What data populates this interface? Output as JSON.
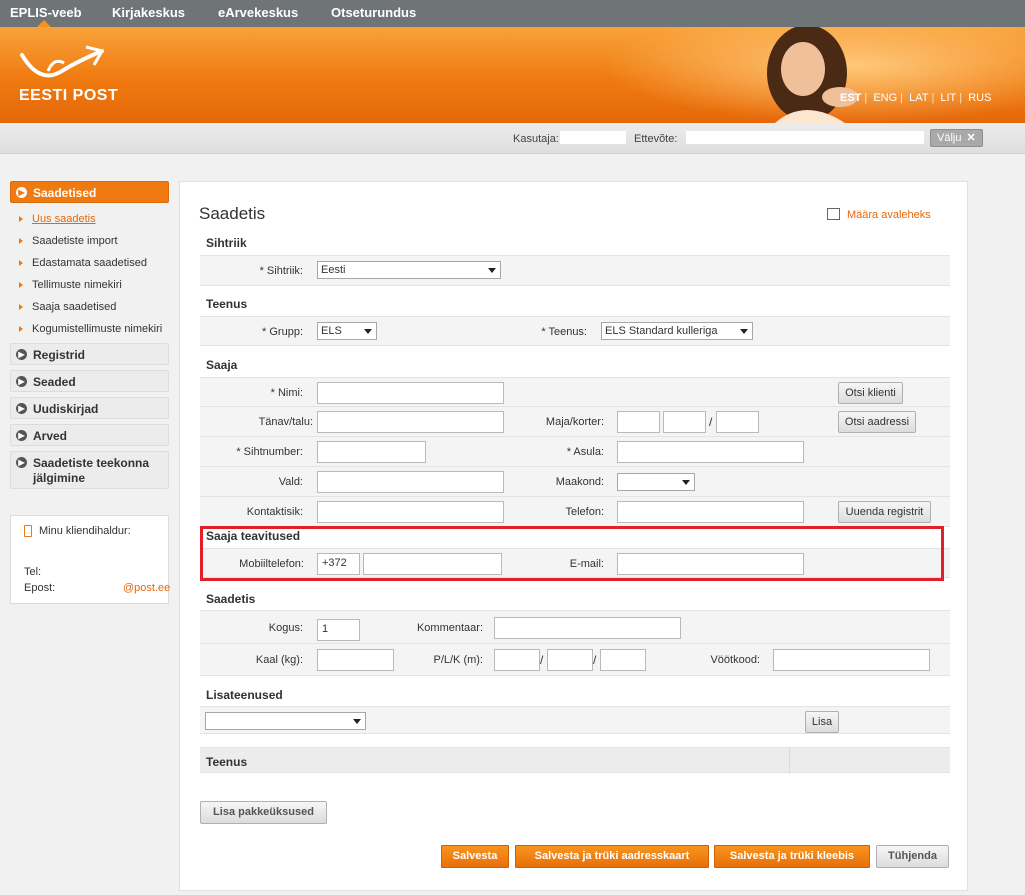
{
  "topnav": {
    "items": [
      "EPLIS-veeb",
      "Kirjakeskus",
      "eArvekeskus",
      "Otseturundus"
    ]
  },
  "brand": {
    "logo_text": "EESTI POST",
    "accent": "#f07a12"
  },
  "languages": [
    "EST",
    "ENG",
    "LAT",
    "LIT",
    "RUS"
  ],
  "userbar": {
    "user_label": "Kasutaja:",
    "company_label": "Ettevõte:",
    "logout_label": "Välju"
  },
  "sidebar": {
    "items": [
      {
        "label": "Saadetised",
        "active": true
      },
      {
        "label": "Registrid"
      },
      {
        "label": "Seaded"
      },
      {
        "label": "Uudiskirjad"
      },
      {
        "label": "Arved"
      },
      {
        "label": "Saadetiste teekonna jälgimine"
      }
    ],
    "subitems": [
      "Uus saadetis",
      "Saadetiste import",
      "Edastamata saadetised",
      "Tellimuste nimekiri",
      "Saaja saadetised",
      "Kogumistellimuste nimekiri"
    ],
    "contact": {
      "title": "Minu kliendihaldur:",
      "tel_label": "Tel:",
      "email_label": "Epost:",
      "email_domain": "@post.ee"
    }
  },
  "main": {
    "title": "Saadetis",
    "home_link": "Määra avaleheks",
    "sections": {
      "sihtriik": "Sihtriik",
      "teenus": "Teenus",
      "saaja": "Saaja",
      "teavitused": "Saaja teavitused",
      "saadetis": "Saadetis",
      "lisateenused": "Lisateenused",
      "teenus_table": "Teenus"
    },
    "form": {
      "sihtriik_label": "* Sihtriik:",
      "sihtriik_value": "Eesti",
      "grupp_label": "* Grupp:",
      "grupp_value": "ELS",
      "teenus_label": "* Teenus:",
      "teenus_value": "ELS Standard kulleriga",
      "nimi_label": "* Nimi:",
      "tanav_label": "Tänav/talu:",
      "maja_label": "Maja/korter:",
      "sihtnumber_label": "* Sihtnumber:",
      "asula_label": "* Asula:",
      "vald_label": "Vald:",
      "maakond_label": "Maakond:",
      "kontaktisik_label": "Kontaktisik:",
      "telefon_label": "Telefon:",
      "mobiil_label": "Mobiiltelefon:",
      "mobiil_prefix": "+372",
      "email_label": "E-mail:",
      "kogus_label": "Kogus:",
      "kogus_value": "1",
      "kommentaar_label": "Kommentaar:",
      "kaal_label": "Kaal (kg):",
      "plk_label": "P/L/K (m):",
      "vootkood_label": "Vöötkood:"
    },
    "buttons": {
      "otsi_klienti": "Otsi klienti",
      "otsi_aadressi": "Otsi aadressi",
      "uuenda_registrit": "Uuenda registrit",
      "lisa": "Lisa",
      "lisa_pakkeuksused": "Lisa pakkeüksused",
      "salvesta": "Salvesta",
      "salvesta_aadresskaart": "Salvesta ja trüki aadresskaart",
      "salvesta_kleebis": "Salvesta ja trüki kleebis",
      "tuhjenda": "Tühjenda"
    }
  }
}
